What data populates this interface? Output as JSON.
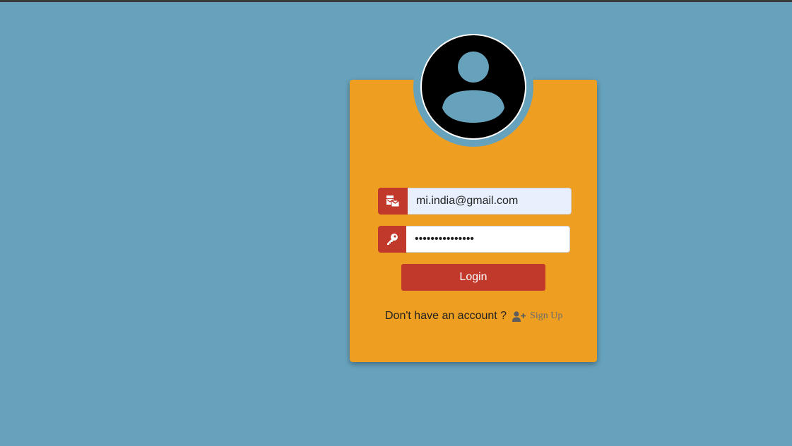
{
  "login_form": {
    "email_value": "mi.india@gmail.com",
    "email_icon": "mail-bulk-icon",
    "password_value": "•••••••••••••••",
    "password_icon": "key-icon",
    "login_label": "Login",
    "signup_question": "Don't have an account ?",
    "signup_icon": "user-plus-icon",
    "signup_label": "Sign Up"
  },
  "avatar": {
    "icon": "user-avatar-icon"
  },
  "colors": {
    "background": "#67a2bc",
    "card": "#ee9f21",
    "accent": "#c0392b"
  }
}
